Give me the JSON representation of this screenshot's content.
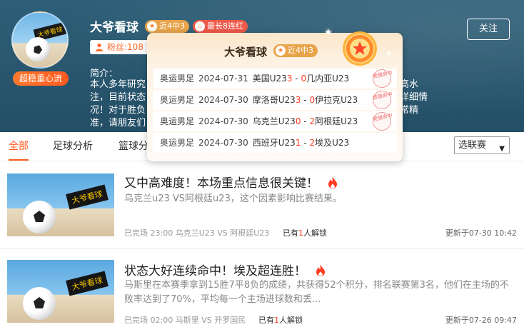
{
  "header": {
    "expert_name": "大爷看球",
    "badge_label": "超稳重心流",
    "avatar_tag": "大爷看球",
    "pill_recent": "近4中3",
    "pill_streak": "最长8连红",
    "fans_label": "粉丝:108",
    "follow_button": "关注",
    "intro_label": "简介：",
    "intro_lines": [
      "本人多年研究",
      "注，目前状态",
      "况！对于胜负",
      "准，请朋友们"
    ],
    "intro_right_lines": [
      "高水",
      "详细情",
      "常精"
    ]
  },
  "tabs": {
    "items": [
      "全部",
      "足球分析",
      "篮球分"
    ],
    "active": "全部",
    "league_select": "选联赛"
  },
  "popup": {
    "title": "大爷看球",
    "pill": "近4中3",
    "stamp_text": "竞猜命中",
    "rows": [
      {
        "league": "奥运男足",
        "date": "2024-07-31",
        "home": "美国U23",
        "home_score": "3",
        "sep": " - ",
        "away_score": "0",
        "away": "几内亚U23"
      },
      {
        "league": "奥运男足",
        "date": "2024-07-30",
        "home": "摩洛哥U23",
        "home_score": "3",
        "sep": " - ",
        "away_score": "0",
        "away": "伊拉克U23"
      },
      {
        "league": "奥运男足",
        "date": "2024-07-30",
        "home": "乌克兰U23",
        "home_score": "0",
        "sep": " - ",
        "away_score": "2",
        "away": "阿根廷U23"
      },
      {
        "league": "奥运男足",
        "date": "2024-07-30",
        "home": "西班牙U23",
        "home_score": "1",
        "sep": " - ",
        "away_score": "2",
        "away": "埃及U23"
      }
    ]
  },
  "articles": [
    {
      "thumb_tag": "大爷看球",
      "title": "又中高难度！本场重点信息很关键！",
      "summary": "乌克兰u23 VS阿根廷u23，这个因素影响比赛结果。",
      "meta": "已完场 23:00 乌克兰U23 VS 阿根廷U23",
      "unlock_prefix": "已有",
      "unlock_count": "1",
      "unlock_suffix": "人解锁",
      "updated": "更新于07-30 10:42"
    },
    {
      "thumb_tag": "大爷看球",
      "title": "状态大好连续命中！埃及超连胜！",
      "summary": "马斯里在本赛季拿到15胜7平8负的成绩，共获得52个积分，排名联赛第3名，他们在主场的不败率达到了70%，平均每一个主场进球数和丢...",
      "meta": "已完场 02:00 马斯里 VS 开罗国民",
      "unlock_prefix": "已有",
      "unlock_count": "1",
      "unlock_suffix": "人解锁",
      "updated": "更新于07-26 09:47"
    }
  ],
  "colors": {
    "accent": "#ff5a1f",
    "header_bg": "#2a5870",
    "score_red": "#ff3b1f",
    "pill_gold": "#e8a44a"
  }
}
